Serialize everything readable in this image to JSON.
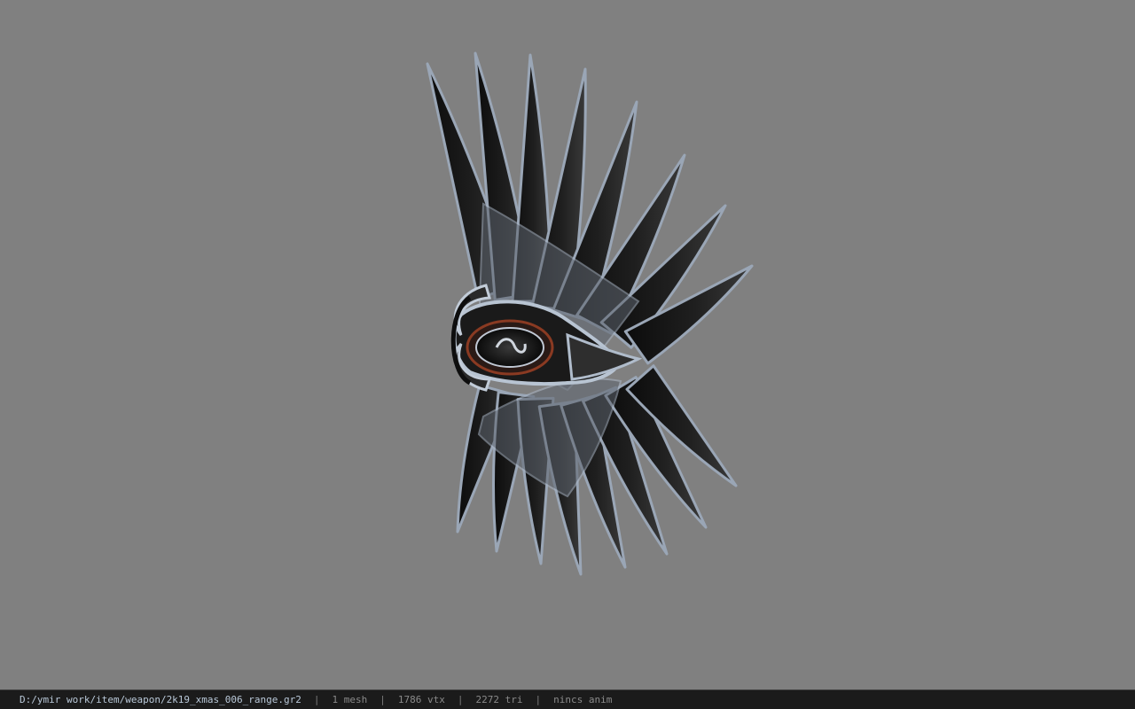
{
  "viewport": {
    "background_color": "#808080",
    "model_icon": "winged-shield-weapon-icon"
  },
  "status_bar": {
    "file_path": "D:/ymir work/item/weapon/2k19_xmas_006_range.gr2",
    "separator": "|",
    "mesh_count": "1 mesh",
    "vertex_count": "1786 vtx",
    "triangle_count": "2272 tri",
    "anim_info": "nincs anim"
  }
}
